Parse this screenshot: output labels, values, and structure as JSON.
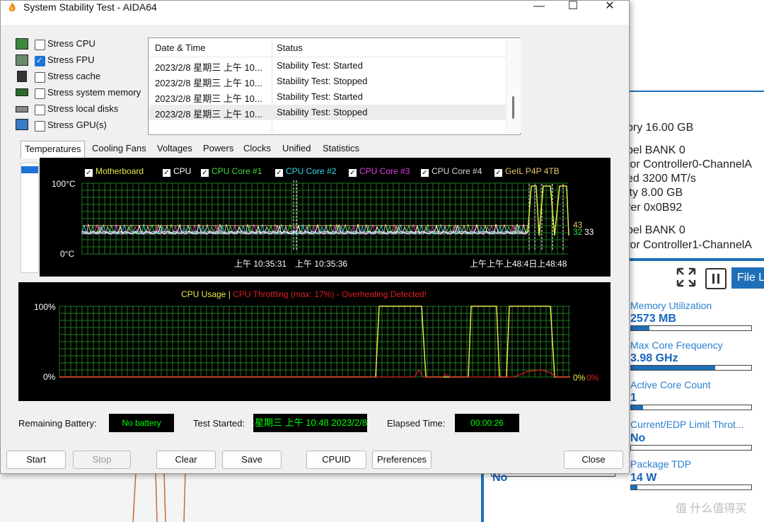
{
  "window": {
    "title": "System Stability Test - AIDA64"
  },
  "stress_options": [
    {
      "label": "Stress CPU",
      "checked": false,
      "icon": "cpu-chip-icon"
    },
    {
      "label": "Stress FPU",
      "checked": true,
      "icon": "fpu-icon"
    },
    {
      "label": "Stress cache",
      "checked": false,
      "icon": "cache-icon"
    },
    {
      "label": "Stress system memory",
      "checked": false,
      "icon": "memory-module-icon"
    },
    {
      "label": "Stress local disks",
      "checked": false,
      "icon": "disk-icon"
    },
    {
      "label": "Stress GPU(s)",
      "checked": false,
      "icon": "gpu-monitor-icon"
    }
  ],
  "log": {
    "columns": [
      "Date & Time",
      "Status"
    ],
    "rows": [
      [
        "2023/2/8 星期三 上午 10...",
        "Stability Test: Started"
      ],
      [
        "2023/2/8 星期三 上午 10...",
        "Stability Test: Stopped"
      ],
      [
        "2023/2/8 星期三 上午 10...",
        "Stability Test: Started"
      ],
      [
        "2023/2/8 星期三 上午 10...",
        "Stability Test: Stopped"
      ]
    ]
  },
  "tabs": [
    "Temperatures",
    "Cooling Fans",
    "Voltages",
    "Powers",
    "Clocks",
    "Unified",
    "Statistics"
  ],
  "temp_graph": {
    "legend": [
      {
        "label": "Motherboard",
        "color": "#e8e84a"
      },
      {
        "label": "CPU",
        "color": "#ffffff"
      },
      {
        "label": "CPU Core #1",
        "color": "#39e039"
      },
      {
        "label": "CPU Core #2",
        "color": "#39d6e8"
      },
      {
        "label": "CPU Core #3",
        "color": "#e040e0"
      },
      {
        "label": "CPU Core #4",
        "color": "#d8d8d8"
      },
      {
        "label": "GeIL P4P 4TB",
        "color": "#e8c86a"
      }
    ],
    "y_top": "100°C",
    "y_bottom": "0°C",
    "times": [
      "上午 10:35:31",
      "上午 10:35:36",
      "上午上午上48:4日上48:48"
    ],
    "value_43": "43",
    "value_32": "32",
    "value_33": "33"
  },
  "cpu_graph": {
    "title": "CPU Usage",
    "separator": "|",
    "throttle": "CPU Throttling (max: 17%) - Overheating Detected!",
    "y_top": "100%",
    "y_bottom": "0%",
    "value_usage": "0%",
    "value_throttle": "0%"
  },
  "fields": {
    "battery_label": "Remaining Battery:",
    "battery_value": "No battery",
    "started_label": "Test Started:",
    "started_value": "2023/2/8 星期三 上午 10:48:",
    "elapsed_label": "Elapsed Time:",
    "elapsed_value": "00:00:26"
  },
  "buttons": {
    "start": "Start",
    "stop": "Stop",
    "clear": "Clear",
    "save": "Save",
    "cpuid": "CPUID",
    "preferences": "Preferences",
    "close": "Close"
  },
  "background": {
    "memory_lines": [
      "ory 16.00 GB",
      "bel BANK 0",
      "tor Controller0-ChannelA",
      "ed 3200 MT/s",
      "ity 8.00 GB",
      "rer 0x0B92",
      "bel BANK 0",
      "tor Controller1-ChannelA"
    ],
    "file_button": "File L",
    "stats": [
      {
        "label": "Memory Utilization",
        "value": "2573  MB",
        "fill": 0.15
      },
      {
        "label": "Max Core Frequency",
        "value": "3.98 GHz",
        "fill": 0.7
      },
      {
        "label": "Active Core Count",
        "value": "1",
        "fill": 0.1
      },
      {
        "label": "Current/EDP Limit Throt...",
        "value": "No",
        "fill": 0
      },
      {
        "label": "Package TDP",
        "value": "14 W",
        "fill": 0.05
      }
    ],
    "left_no": "No",
    "watermark": "值 什么值得买"
  }
}
